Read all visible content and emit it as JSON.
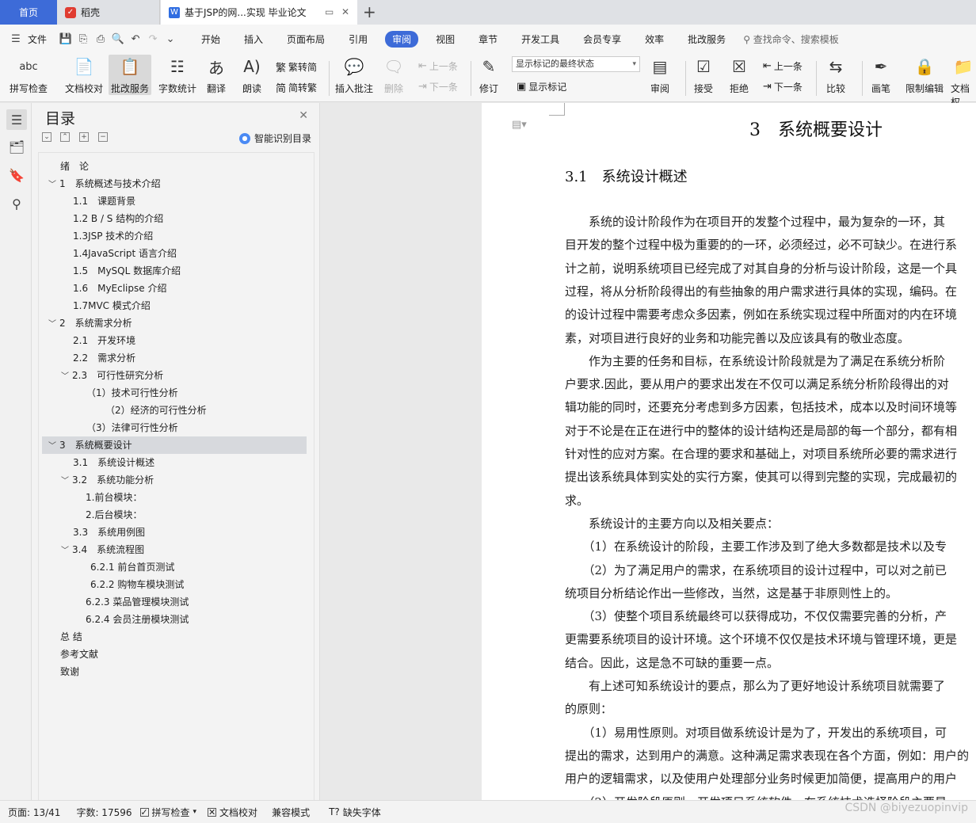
{
  "tabs": {
    "home": "首页",
    "daoke": "稻壳",
    "doc": "基于JSP的网...实现 毕业论文"
  },
  "menu": {
    "file": "文件",
    "items": [
      "开始",
      "插入",
      "页面布局",
      "引用",
      "审阅",
      "视图",
      "章节",
      "开发工具",
      "会员专享",
      "效率",
      "批改服务"
    ],
    "active": "审阅",
    "search": "查找命令、搜索模板"
  },
  "ribbon": {
    "spell_check": "拼写检查",
    "doc_proof": "文档校对",
    "correction_service": "批改服务",
    "word_count": "字数统计",
    "translate": "翻译",
    "read_aloud": "朗读",
    "trad_to_simp": "繁转简",
    "simp_to_trad": "简转繁",
    "insert_comment": "插入批注",
    "delete": "删除",
    "prev_comment": "上一条",
    "next_comment": "下一条",
    "revise": "修订",
    "markup_select": "显示标记的最终状态",
    "show_markup": "显示标记",
    "review": "审阅",
    "accept": "接受",
    "reject": "拒绝",
    "prev_change": "上一条",
    "next_change": "下一条",
    "compare": "比较",
    "ink": "画笔",
    "restrict_edit": "限制编辑",
    "doc_perm": "文档权"
  },
  "toc": {
    "title": "目录",
    "smart": "智能识别目录",
    "items": [
      "绪　论",
      "1　系统概述与技术介绍",
      "1.1　课题背景",
      "1.2 B / S 结构的介绍",
      "1.3JSP 技术的介绍",
      "1.4JavaScript 语言介绍",
      "1.5　MySQL 数据库介绍",
      "1.6　MyEclipse 介绍",
      "1.7MVC 模式介绍",
      "2　系统需求分析",
      "2.1　开发环境",
      "2.2　需求分析",
      "2.3　可行性研究分析",
      "（1）技术可行性分析",
      "（2）经济的可行性分析",
      "（3）法律可行性分析",
      "3　系统概要设计",
      "3.1　系统设计概述",
      "3.2　系统功能分析",
      "1.前台模块：",
      "2.后台模块：",
      "3.3　系统用例图",
      "3.4　系统流程图",
      "6.2.1 前台首页测试",
      "6.2.2 购物车模块测试",
      "6.2.3 菜品管理模块测试",
      "6.2.4 会员注册模块测试",
      "总 结",
      "参考文献",
      "致谢"
    ]
  },
  "doc": {
    "h1": "3　系统概要设计",
    "h2": "3.1　系统设计概述",
    "lines": [
      "　　系统的设计阶段作为在项目开的发整个过程中，最为复杂的一环，其",
      "目开发的整个过程中极为重要的的一环，必须经过，必不可缺少。在进行系",
      "计之前，说明系统项目已经完成了对其自身的分析与设计阶段，这是一个具",
      "过程，将从分析阶段得出的有些抽象的用户需求进行具体的实现，编码。在",
      "的设计过程中需要考虑众多因素，例如在系统实现过程中所面对的内在环境",
      "素，对项目进行良好的业务和功能完善以及应该具有的敬业态度。",
      "　　作为主要的任务和目标，在系统设计阶段就是为了满足在系统分析阶",
      "户要求.因此，要从用户的要求出发在不仅可以满足系统分析阶段得出的对",
      "辑功能的同时，还要充分考虑到多方因素，包括技术，成本以及时间环境等",
      "对于不论是在正在进行中的整体的设计结构还是局部的每一个部分，都有相",
      "针对性的应对方案。在合理的要求和基础上，对项目系统所必要的需求进行",
      "提出该系统具体到实处的实行方案，使其可以得到完整的实现，完成最初的",
      "求。",
      "　　系统设计的主要方向以及相关要点：",
      "　　（1）在系统设计的阶段，主要工作涉及到了绝大多数都是技术以及专",
      "　　（2）为了满足用户的需求，在系统项目的设计过程中，可以对之前已",
      "统项目分析结论作出一些修改，当然，这是基于非原则性上的。",
      "　　（3）使整个项目系统最终可以获得成功，不仅仅需要完善的分析，产",
      "更需要系统项目的设计环境。这个环境不仅仅是技术环境与管理环境，更是",
      "结合。因此，这是急不可缺的重要一点。",
      "　　有上述可知系统设计的要点，那么为了更好地设计系统项目就需要了",
      "的原则：",
      "　　（1）易用性原则。对项目做系统设计是为了，开发出的系统项目，可",
      "提出的需求，达到用户的满意。这种满足需求表现在各个方面，例如：用户的",
      "用户的逻辑需求，以及使用户处理部分业务时候更加简便，提高用户的用户",
      "　　（2）开发阶段原则。开发项目系统软件，在系统技术选择阶段主要是"
    ]
  },
  "status": {
    "page": "页面: 13/41",
    "words": "字数: 17596",
    "spell": "拼写检查",
    "proof": "文档校对",
    "compat": "兼容模式",
    "missing_font": "缺失字体"
  },
  "watermark": "CSDN @biyezuopinvip"
}
